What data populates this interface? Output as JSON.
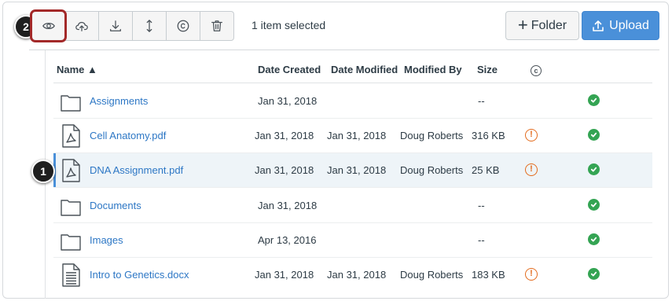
{
  "toolbar": {
    "icons": [
      "eye-icon",
      "cloud-icon",
      "download-icon",
      "move-icon",
      "copyright-icon",
      "trash-icon"
    ],
    "selection_text": "1 item selected",
    "folder_label": "Folder",
    "folder_plus": "+",
    "upload_label": "Upload"
  },
  "table": {
    "headers": {
      "name": "Name ▲",
      "date_created": "Date Created",
      "date_modified": "Date Modified",
      "modified_by": "Modified By",
      "size": "Size",
      "usage_rights": "c"
    },
    "rows": [
      {
        "name": "Assignments",
        "type": "folder",
        "date_created": "Jan 31, 2018",
        "date_modified": "",
        "modified_by": "",
        "size": "--",
        "warning": false,
        "published": true
      },
      {
        "name": "Cell Anatomy.pdf",
        "type": "pdf",
        "date_created": "Jan 31, 2018",
        "date_modified": "Jan 31, 2018",
        "modified_by": "Doug Roberts",
        "size": "316 KB",
        "warning": true,
        "published": true
      },
      {
        "name": "DNA Assignment.pdf",
        "type": "pdf",
        "date_created": "Jan 31, 2018",
        "date_modified": "Jan 31, 2018",
        "modified_by": "Doug Roberts",
        "size": "25 KB",
        "warning": true,
        "published": true,
        "selected": true
      },
      {
        "name": "Documents",
        "type": "folder",
        "date_created": "Jan 31, 2018",
        "date_modified": "",
        "modified_by": "",
        "size": "--",
        "warning": false,
        "published": true
      },
      {
        "name": "Images",
        "type": "folder",
        "date_created": "Apr 13, 2016",
        "date_modified": "",
        "modified_by": "",
        "size": "--",
        "warning": false,
        "published": true
      },
      {
        "name": "Intro to Genetics.docx",
        "type": "doc",
        "date_created": "Jan 31, 2018",
        "date_modified": "Jan 31, 2018",
        "modified_by": "Doug Roberts",
        "size": "183 KB",
        "warning": true,
        "published": true
      }
    ],
    "warning_glyph": "!"
  },
  "callouts": {
    "one": "1",
    "two": "2"
  },
  "colors": {
    "link": "#2d77c5",
    "upload_bg": "#4a90d9",
    "published": "#34a453",
    "warning": "#e36b1d",
    "highlight_outline": "#a32929",
    "selected_row_bg": "#eef4f8"
  }
}
